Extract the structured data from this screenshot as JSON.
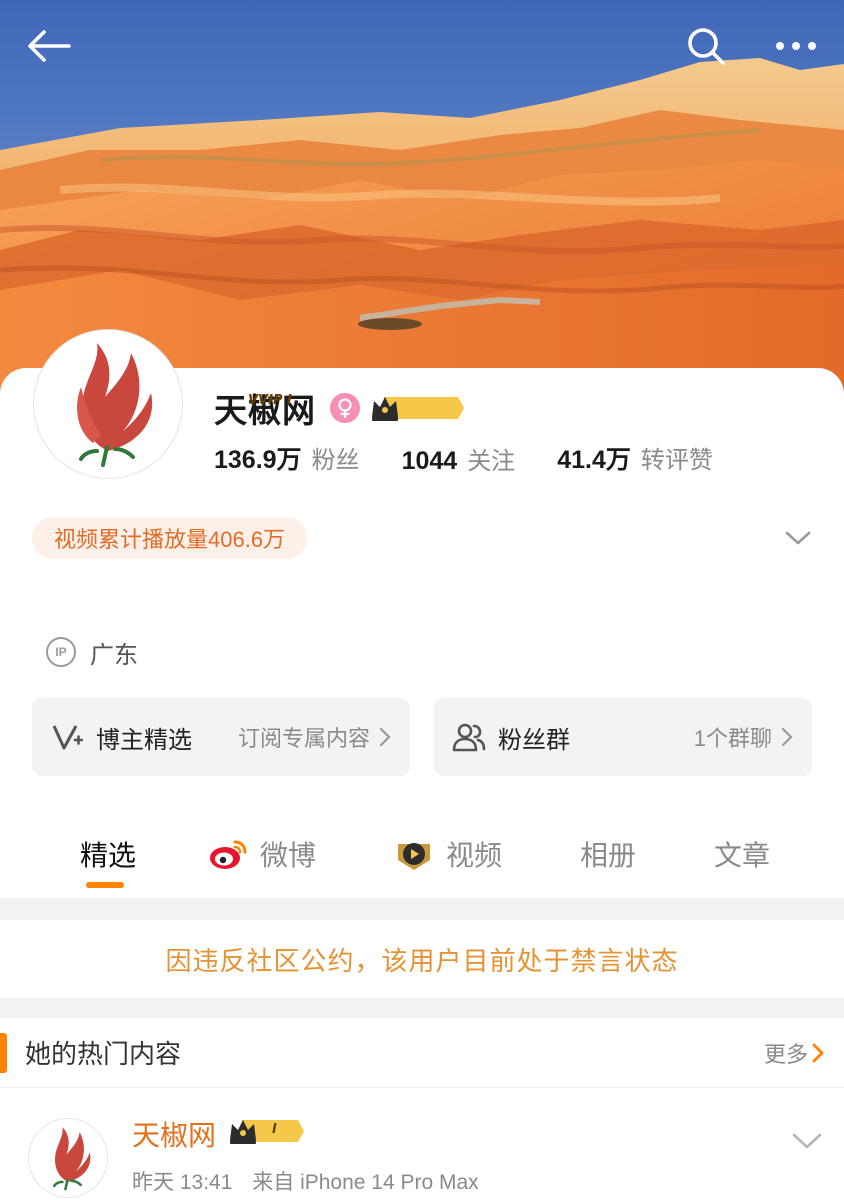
{
  "header": {
    "back_icon": "arrow-left-icon",
    "search_icon": "search-icon",
    "more_icon": "more-dots-icon",
    "banner_icon": "landscape-banner"
  },
  "profile": {
    "name": "天椒网",
    "gender_icon": "female-icon",
    "gender_color": "#f58fb3",
    "vip_badge": "VVIP I",
    "stats": [
      {
        "value": "136.9万",
        "label": "粉丝"
      },
      {
        "value": "1044",
        "label": "关注"
      },
      {
        "value": "41.4万",
        "label": "转评赞"
      }
    ],
    "video_plays": "视频累计播放量406.6万",
    "ip_icon": "IP",
    "ip_location": "广东"
  },
  "features": {
    "left": {
      "title": "博主精选",
      "subtitle": "订阅专属内容"
    },
    "right": {
      "title": "粉丝群",
      "subtitle": "1个群聊"
    }
  },
  "tabs": [
    {
      "label": "精选",
      "active": true
    },
    {
      "label": "微博"
    },
    {
      "label": "视频"
    },
    {
      "label": "相册"
    },
    {
      "label": "文章"
    }
  ],
  "notice": "因违反社区公约，该用户目前处于禁言状态",
  "hot": {
    "title": "她的热门内容",
    "more": "更多"
  },
  "post": {
    "author": "天椒网",
    "badge": "I",
    "time": "昨天 13:41",
    "source": "来自 iPhone 14 Pro Max"
  },
  "colors": {
    "accent": "#ff8200",
    "notice": "#e69132",
    "sky": "#5f86c9",
    "mountain_orange": "#f08a3c"
  }
}
